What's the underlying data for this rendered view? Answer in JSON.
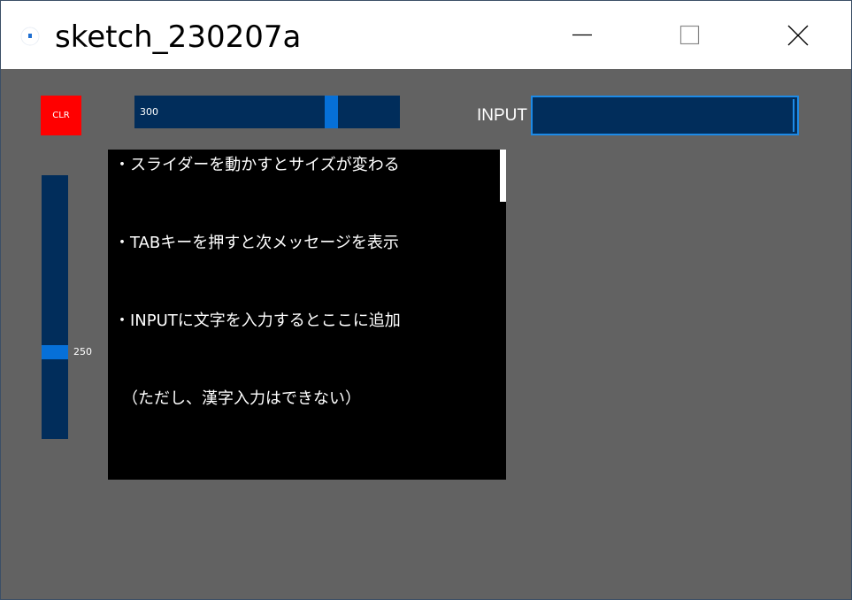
{
  "window": {
    "title": "sketch_230207a",
    "icon": "processing-app-icon",
    "controls": [
      "minimize-icon",
      "maximize-icon",
      "close-icon"
    ]
  },
  "canvas": {
    "background": "#626262",
    "clr_button": {
      "label": "CLR",
      "color": "#ff0000"
    },
    "size_slider": {
      "value": "300",
      "fraction": 0.76,
      "track_color": "#012d5b",
      "thumb_color": "#0670d8"
    },
    "input": {
      "label": "INPUT",
      "value": ""
    },
    "vertical_slider": {
      "value": "250",
      "fraction": 0.7
    },
    "messages": [
      "・スライダーを動かすとサイズが変わる",
      "・TABキーを押すと次メッセージを表示",
      "・INPUTに文字を入力するとここに追加",
      "　（ただし、漢字入力はできない）"
    ]
  }
}
